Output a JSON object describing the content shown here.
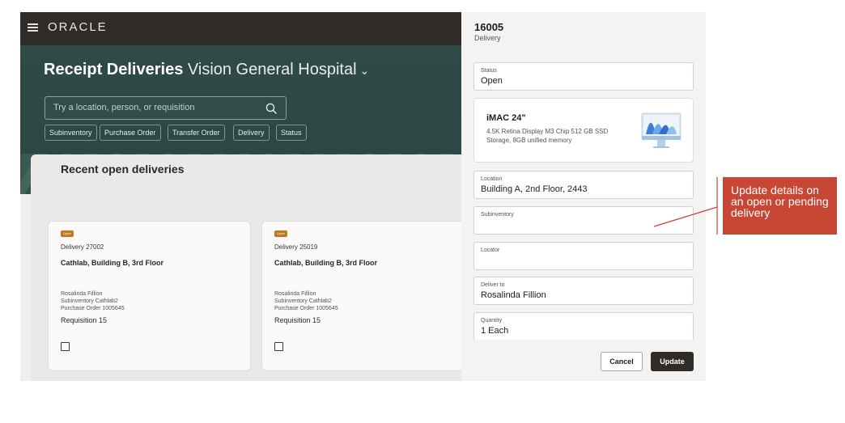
{
  "header": {
    "brand": "ORACLE",
    "menu_icon": "hamburger-menu-icon"
  },
  "page": {
    "title": "Receipt Deliveries",
    "location": "Vision General Hospital",
    "location_chevron": "⌄",
    "search": {
      "placeholder": "Try a location, person, or requisition",
      "icon": "search-icon"
    },
    "filters": [
      "Subinventory",
      "Purchase Order",
      "Transfer Order",
      "Delivery",
      "Status"
    ]
  },
  "recent": {
    "title": "Recent open deliveries",
    "cards": [
      {
        "badge": "Open",
        "delivery": "Delivery 27002",
        "location": "Cathlab, Building B, 3rd Floor",
        "person": "Rosalinda Fillion",
        "subinventory": "Subinventory Cathlab2",
        "purchase_order": "Purchase Order 1005645",
        "requisition": "Requisition 15"
      },
      {
        "badge": "Open",
        "delivery": "Delivery 25019",
        "location": "Cathlab, Building B, 3rd Floor",
        "person": "Rosalinda Fillion",
        "subinventory": "Subinventory Cathlab2",
        "purchase_order": "Purchase Order 1005645",
        "requisition": "Requisition 15"
      }
    ]
  },
  "drawer": {
    "id": "16005",
    "type": "Delivery",
    "status": {
      "label": "Status",
      "value": "Open"
    },
    "product": {
      "name": "iMAC 24\"",
      "description": "4.5K Retina Display M3 Chip 512 GB SSD Storage, 8GB unified memory",
      "image": "imac-image"
    },
    "location": {
      "label": "Location",
      "value": "Building A, 2nd Floor, 2443"
    },
    "subinventory": {
      "label": "Subinventory",
      "value": ""
    },
    "locator": {
      "label": "Locator",
      "value": ""
    },
    "deliver_to": {
      "label": "Deliver to",
      "value": "Rosalinda Fillion"
    },
    "quantity": {
      "label": "Quantity",
      "value": "1 Each"
    },
    "cancel_label": "Cancel",
    "update_label": "Update"
  },
  "callout": {
    "text": "Update details on an open or pending delivery",
    "color": "#c74634"
  },
  "colors": {
    "header": "#2e2b29",
    "hero": "#2f4a47",
    "badge": "#c1771e",
    "primary_button": "#2e2b29"
  }
}
